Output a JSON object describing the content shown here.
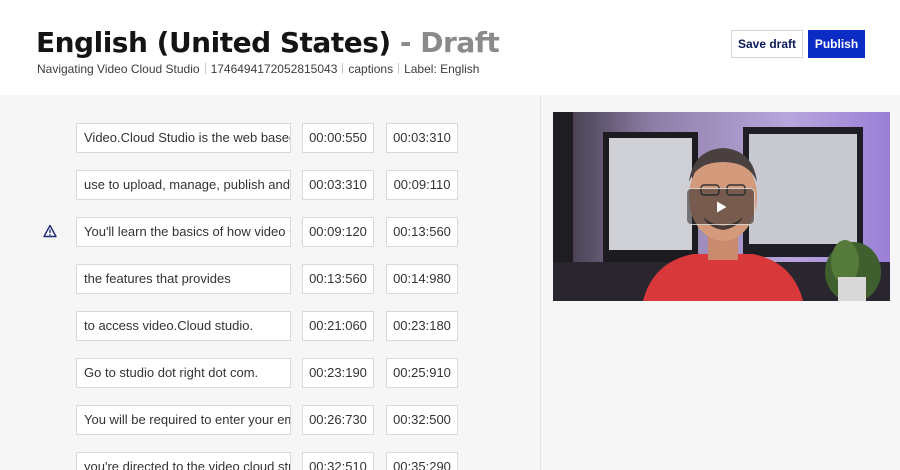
{
  "header": {
    "language": "English (United States)",
    "status": "- Draft",
    "video_name": "Navigating Video Cloud Studio",
    "video_id": "1746494172052815043",
    "kind": "captions",
    "label": "Label: English",
    "save_label": "Save draft",
    "publish_label": "Publish"
  },
  "colors": {
    "primary": "#0b2bc5",
    "draft": "#8a8a8a",
    "warning": "#1f2a7a"
  },
  "cues": [
    {
      "text": "Video.Cloud Studio is the web based",
      "start": "00:00:550",
      "end": "00:03:310",
      "warning": false
    },
    {
      "text": "use to upload, manage, publish and",
      "start": "00:03:310",
      "end": "00:09:110",
      "warning": false
    },
    {
      "text": "You'll learn the basics of how video Cloud",
      "start": "00:09:120",
      "end": "00:13:560",
      "warning": true
    },
    {
      "text": "the features that provides",
      "start": "00:13:560",
      "end": "00:14:980",
      "warning": false
    },
    {
      "text": "to access video.Cloud studio.",
      "start": "00:21:060",
      "end": "00:23:180",
      "warning": false
    },
    {
      "text": "Go to studio dot right dot com.",
      "start": "00:23:190",
      "end": "00:25:910",
      "warning": false
    },
    {
      "text": "You will be required to enter your email",
      "start": "00:26:730",
      "end": "00:32:500",
      "warning": false
    },
    {
      "text": "you're directed to the video cloud studio",
      "start": "00:32:510",
      "end": "00:35:290",
      "warning": false
    }
  ],
  "icons": {
    "warning": "warning-triangle-icon",
    "play": "play-icon"
  }
}
